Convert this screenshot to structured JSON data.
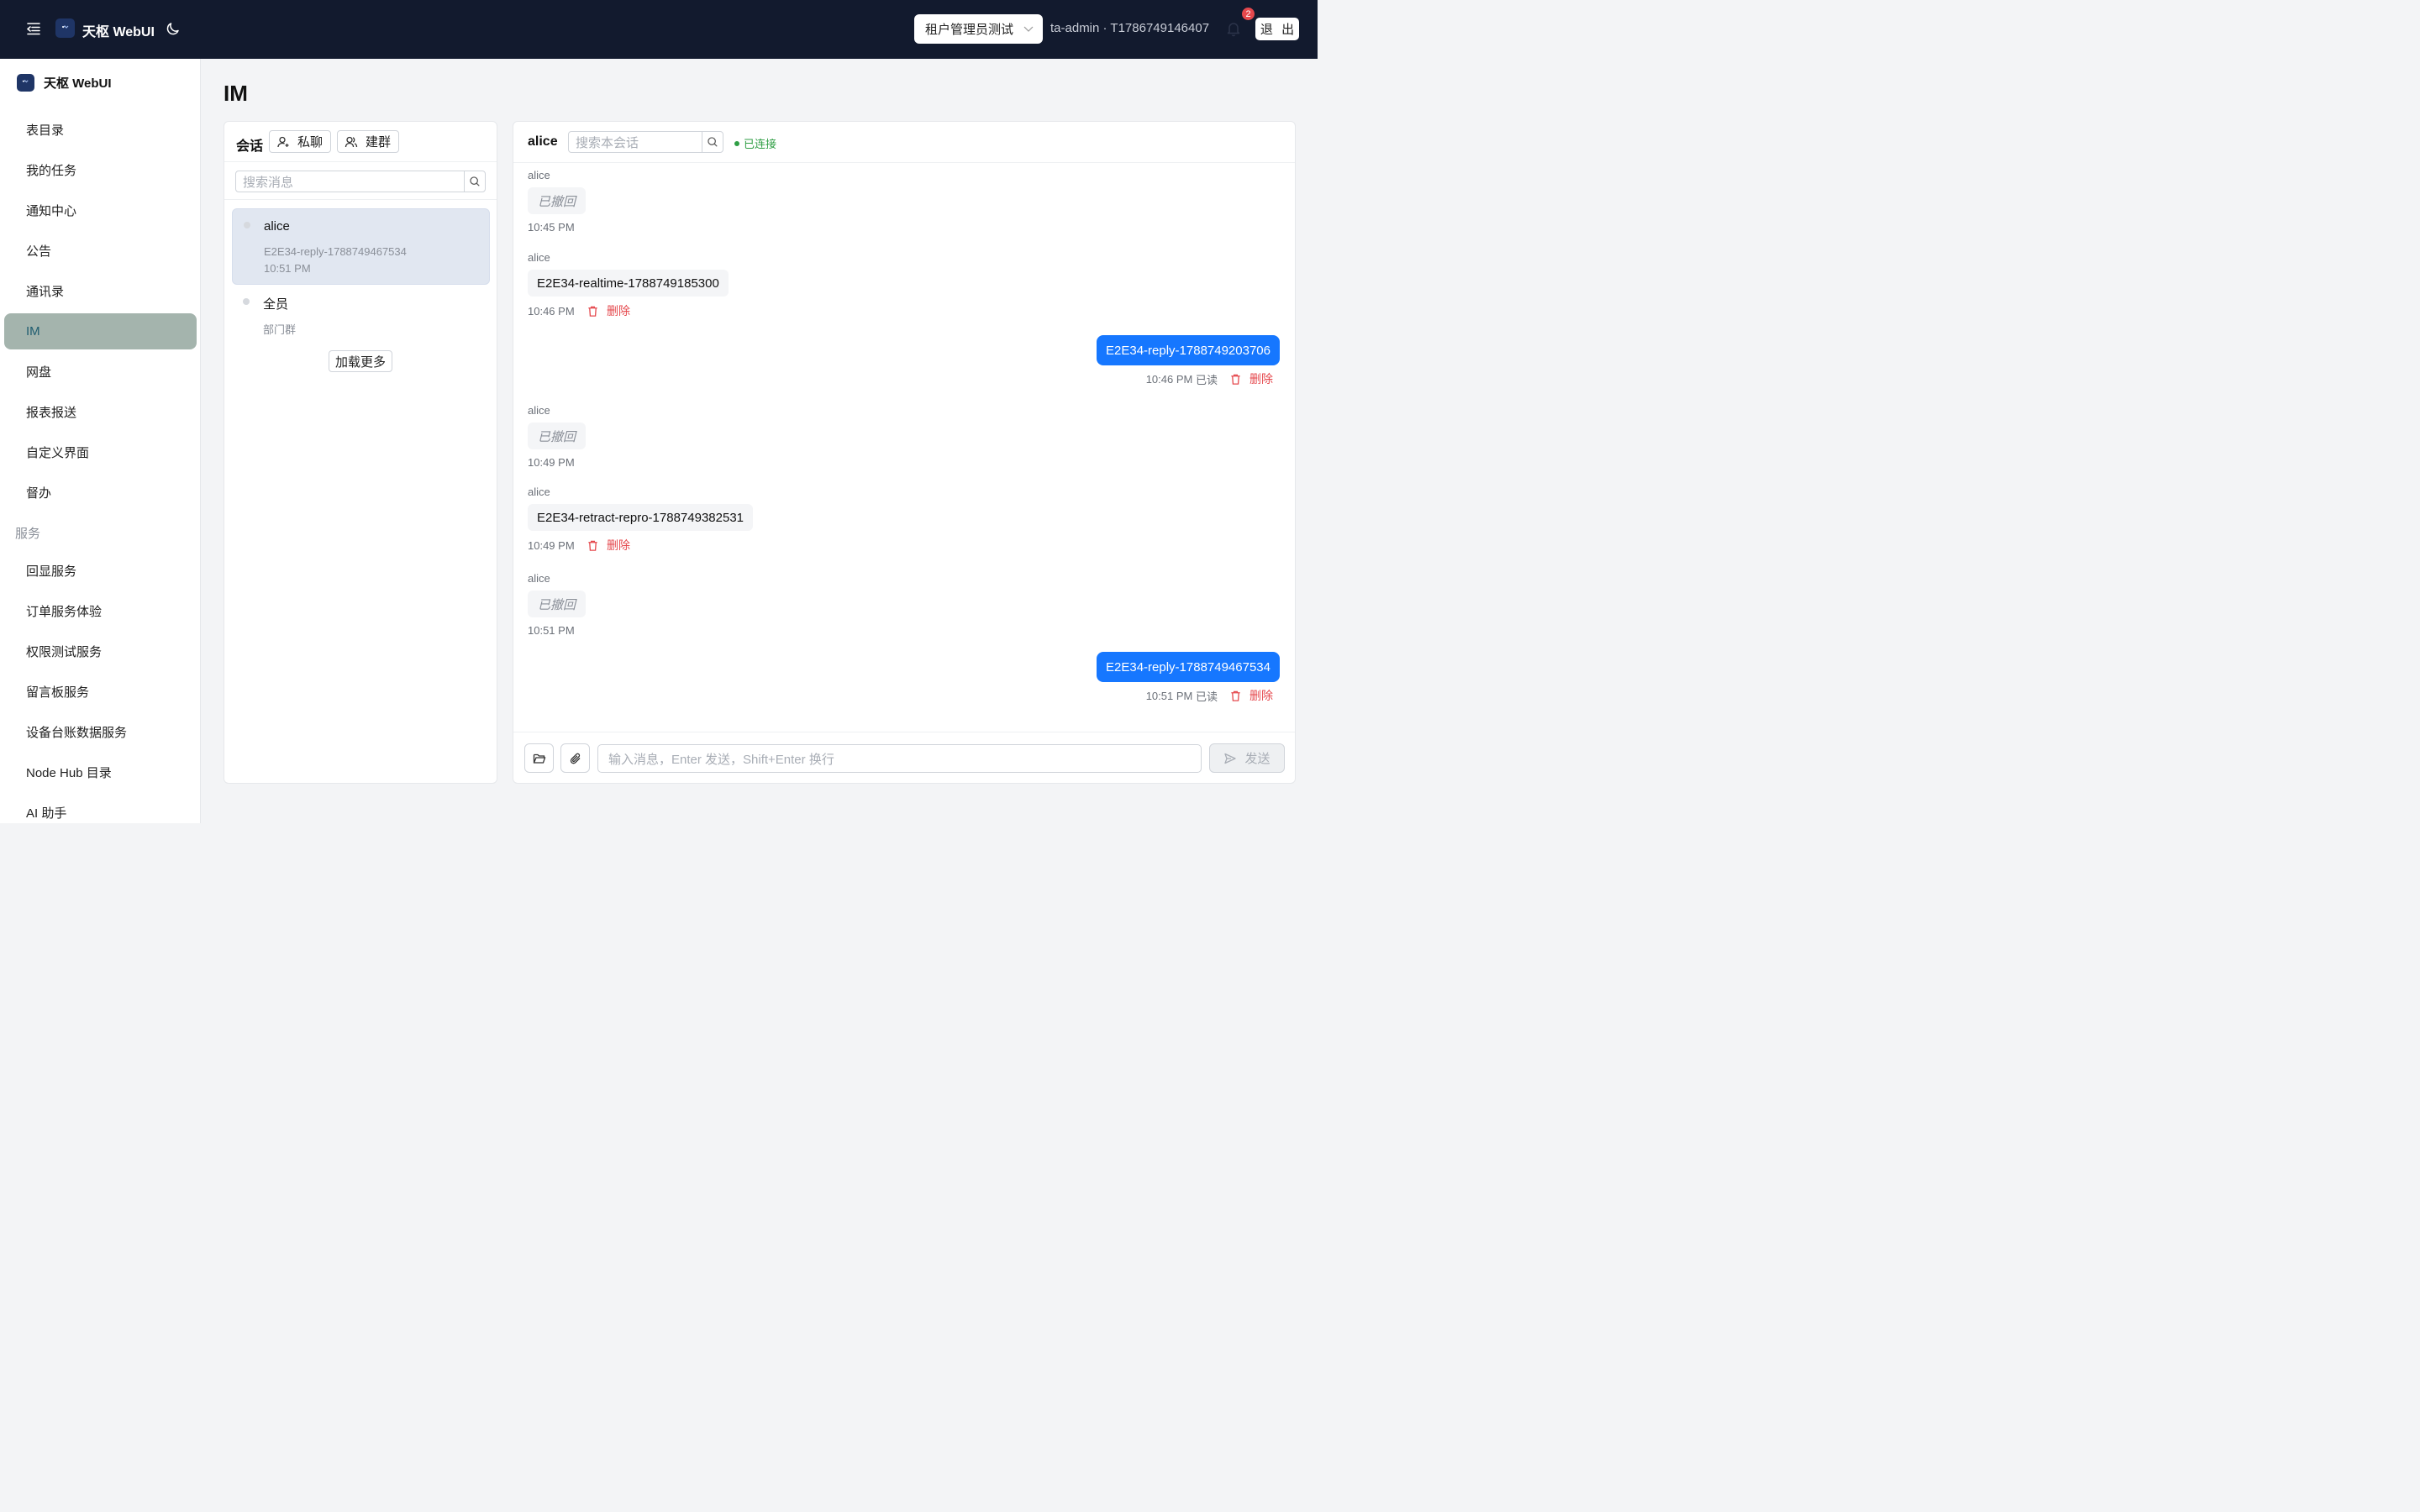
{
  "topbar": {
    "app_title": "天枢 WebUI",
    "tenant_selected": "租户管理员测试",
    "user_info": "ta-admin · T1786749146407",
    "notification_count": "2",
    "logout_label": "退 出",
    "icons": [
      "menu-fold-icon",
      "app-logo-icon",
      "moon-icon",
      "chevron-down-icon",
      "bell-icon"
    ]
  },
  "sidebar": {
    "brand": "天枢 WebUI",
    "items": [
      {
        "label": "表目录"
      },
      {
        "label": "我的任务"
      },
      {
        "label": "通知中心"
      },
      {
        "label": "公告"
      },
      {
        "label": "通讯录"
      },
      {
        "label": "IM",
        "active": true
      },
      {
        "label": "网盘"
      },
      {
        "label": "报表报送"
      },
      {
        "label": "自定义界面"
      },
      {
        "label": "督办"
      }
    ],
    "group_label": "服务",
    "service_items": [
      {
        "label": "回显服务"
      },
      {
        "label": "订单服务体验"
      },
      {
        "label": "权限测试服务"
      },
      {
        "label": "留言板服务"
      },
      {
        "label": "设备台账数据服务"
      },
      {
        "label": "Node Hub 目录"
      },
      {
        "label": "AI 助手"
      }
    ],
    "active_color": "#a4b4ad"
  },
  "page": {
    "title": "IM"
  },
  "conversations": {
    "header_label": "会话",
    "private_chat_label": "私聊",
    "create_group_label": "建群",
    "search_placeholder": "搜索消息",
    "items": [
      {
        "name": "alice",
        "preview": "E2E34-reply-1788749467534",
        "time": "10:51 PM",
        "active": true
      },
      {
        "name": "全员",
        "preview": "部门群"
      }
    ],
    "load_more_label": "加载更多"
  },
  "chat": {
    "peer_name": "alice",
    "search_placeholder": "搜索本会话",
    "status": "已连接",
    "messages": [
      {
        "direction": "in",
        "sender": "alice",
        "text": "已撤回",
        "retracted": true,
        "time": "10:45 PM"
      },
      {
        "direction": "in",
        "sender": "alice",
        "text": "E2E34-realtime-1788749185300",
        "time": "10:46 PM",
        "delete_label": "删除"
      },
      {
        "direction": "out",
        "text": "E2E34-reply-1788749203706",
        "time": "10:46 PM",
        "read": "已读",
        "delete_label": "删除"
      },
      {
        "direction": "in",
        "sender": "alice",
        "text": "已撤回",
        "retracted": true,
        "time": "10:49 PM"
      },
      {
        "direction": "in",
        "sender": "alice",
        "text": "E2E34-retract-repro-1788749382531",
        "time": "10:49 PM",
        "delete_label": "删除"
      },
      {
        "direction": "in",
        "sender": "alice",
        "text": "已撤回",
        "retracted": true,
        "time": "10:51 PM"
      },
      {
        "direction": "out",
        "text": "E2E34-reply-1788749467534",
        "time": "10:51 PM",
        "read": "已读",
        "delete_label": "删除"
      }
    ],
    "input_placeholder": "输入消息，Enter 发送，Shift+Enter 换行",
    "send_label": "发送",
    "colors": {
      "outgoing_bubble": "#1677ff",
      "status_green": "#2f9e44",
      "delete_red": "#e5484d"
    }
  }
}
